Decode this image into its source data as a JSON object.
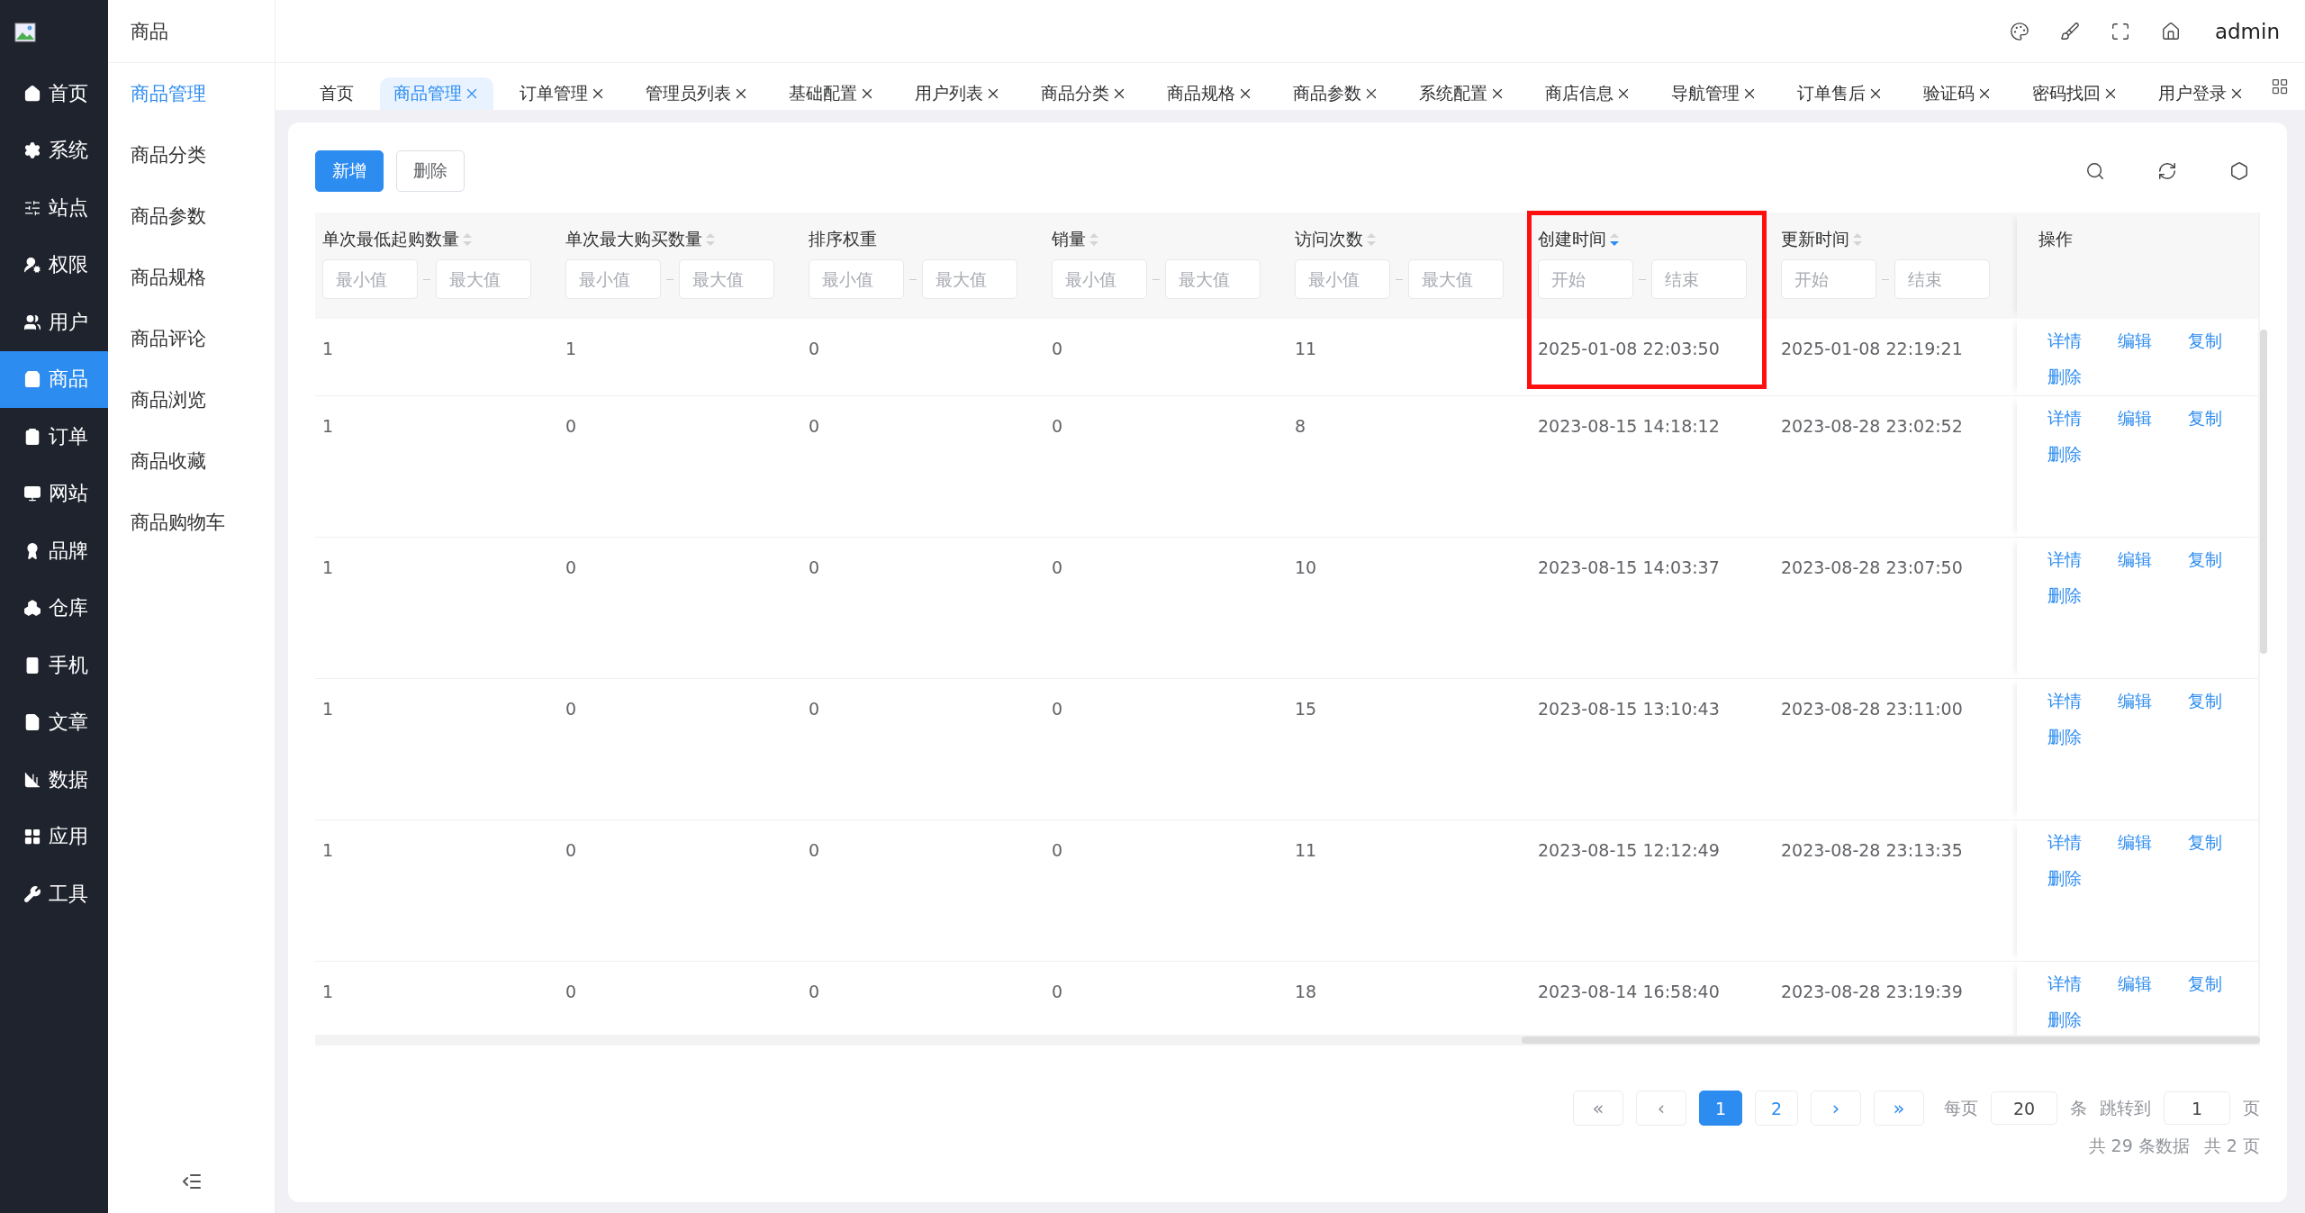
{
  "sidebar": {
    "items": [
      {
        "label": "首页",
        "selected": false
      },
      {
        "label": "系统",
        "selected": false
      },
      {
        "label": "站点",
        "selected": false
      },
      {
        "label": "权限",
        "selected": false
      },
      {
        "label": "用户",
        "selected": false
      },
      {
        "label": "商品",
        "selected": true
      },
      {
        "label": "订单",
        "selected": false
      },
      {
        "label": "网站",
        "selected": false
      },
      {
        "label": "品牌",
        "selected": false
      },
      {
        "label": "仓库",
        "selected": false
      },
      {
        "label": "手机",
        "selected": false
      },
      {
        "label": "文章",
        "selected": false
      },
      {
        "label": "数据",
        "selected": false
      },
      {
        "label": "应用",
        "selected": false
      },
      {
        "label": "工具",
        "selected": false
      }
    ]
  },
  "submenu": {
    "title": "商品",
    "items": [
      {
        "label": "商品管理",
        "selected": true
      },
      {
        "label": "商品分类",
        "selected": false
      },
      {
        "label": "商品参数",
        "selected": false
      },
      {
        "label": "商品规格",
        "selected": false
      },
      {
        "label": "商品评论",
        "selected": false
      },
      {
        "label": "商品浏览",
        "selected": false
      },
      {
        "label": "商品收藏",
        "selected": false
      },
      {
        "label": "商品购物车",
        "selected": false
      }
    ]
  },
  "header": {
    "user": "admin"
  },
  "tabs": [
    {
      "label": "首页",
      "selected": false,
      "closable": false
    },
    {
      "label": "商品管理",
      "selected": true,
      "closable": true
    },
    {
      "label": "订单管理",
      "selected": false,
      "closable": true
    },
    {
      "label": "管理员列表",
      "selected": false,
      "closable": true
    },
    {
      "label": "基础配置",
      "selected": false,
      "closable": true
    },
    {
      "label": "用户列表",
      "selected": false,
      "closable": true
    },
    {
      "label": "商品分类",
      "selected": false,
      "closable": true
    },
    {
      "label": "商品规格",
      "selected": false,
      "closable": true
    },
    {
      "label": "商品参数",
      "selected": false,
      "closable": true
    },
    {
      "label": "系统配置",
      "selected": false,
      "closable": true
    },
    {
      "label": "商店信息",
      "selected": false,
      "closable": true
    },
    {
      "label": "导航管理",
      "selected": false,
      "closable": true
    },
    {
      "label": "订单售后",
      "selected": false,
      "closable": true
    },
    {
      "label": "验证码",
      "selected": false,
      "closable": true
    },
    {
      "label": "密码找回",
      "selected": false,
      "closable": true
    },
    {
      "label": "用户登录",
      "selected": false,
      "closable": true
    }
  ],
  "toolbar": {
    "buttons": [
      {
        "label": "新增",
        "kind": "primary"
      },
      {
        "label": "删除",
        "kind": "default"
      }
    ]
  },
  "table": {
    "columns": [
      {
        "title": "单次最低起购数量",
        "sortable": true,
        "sorted_desc": false,
        "highlighted": false,
        "filter": [
          {
            "placeholder": "最小值"
          },
          {
            "placeholder": "最大值"
          }
        ]
      },
      {
        "title": "单次最大购买数量",
        "sortable": true,
        "sorted_desc": false,
        "highlighted": false,
        "filter": [
          {
            "placeholder": "最小值"
          },
          {
            "placeholder": "最大值"
          }
        ]
      },
      {
        "title": "排序权重",
        "sortable": false,
        "highlighted": false,
        "filter": [
          {
            "placeholder": "最小值"
          },
          {
            "placeholder": "最大值"
          }
        ]
      },
      {
        "title": "销量",
        "sortable": true,
        "sorted_desc": false,
        "highlighted": false,
        "filter": [
          {
            "placeholder": "最小值"
          },
          {
            "placeholder": "最大值"
          }
        ]
      },
      {
        "title": "访问次数",
        "sortable": true,
        "sorted_desc": false,
        "highlighted": false,
        "filter": [
          {
            "placeholder": "最小值"
          },
          {
            "placeholder": "最大值"
          }
        ]
      },
      {
        "title": "创建时间",
        "sortable": true,
        "sorted_desc": true,
        "highlighted": true,
        "filter": [
          {
            "placeholder": "开始"
          },
          {
            "placeholder": "结束"
          }
        ]
      },
      {
        "title": "更新时间",
        "sortable": true,
        "sorted_desc": false,
        "highlighted": false,
        "filter": [
          {
            "placeholder": "开始"
          },
          {
            "placeholder": "结束"
          }
        ]
      },
      {
        "title": "操作",
        "sortable": false,
        "highlighted": false
      }
    ],
    "rows": [
      {
        "cells": [
          "1",
          "1",
          "0",
          "0",
          "11",
          "2025-01-08 22:03:50",
          "2025-01-08 22:19:21"
        ],
        "actions": [
          "详情",
          "编辑",
          "复制",
          "删除"
        ]
      },
      {
        "cells": [
          "1",
          "0",
          "0",
          "0",
          "8",
          "2023-08-15 14:18:12",
          "2023-08-28 23:02:52"
        ],
        "actions": [
          "详情",
          "编辑",
          "复制",
          "删除"
        ]
      },
      {
        "cells": [
          "1",
          "0",
          "0",
          "0",
          "10",
          "2023-08-15 14:03:37",
          "2023-08-28 23:07:50"
        ],
        "actions": [
          "详情",
          "编辑",
          "复制",
          "删除"
        ]
      },
      {
        "cells": [
          "1",
          "0",
          "0",
          "0",
          "15",
          "2023-08-15 13:10:43",
          "2023-08-28 23:11:00"
        ],
        "actions": [
          "详情",
          "编辑",
          "复制",
          "删除"
        ]
      },
      {
        "cells": [
          "1",
          "0",
          "0",
          "0",
          "11",
          "2023-08-15 12:12:49",
          "2023-08-28 23:13:35"
        ],
        "actions": [
          "详情",
          "编辑",
          "复制",
          "删除"
        ]
      },
      {
        "cells": [
          "1",
          "0",
          "0",
          "0",
          "18",
          "2023-08-14 16:58:40",
          "2023-08-28 23:19:39"
        ],
        "actions": [
          "详情",
          "编辑",
          "复制",
          "删除"
        ]
      }
    ]
  },
  "pagination": {
    "nav_before": [
      {
        "label": "«",
        "disabled": true
      },
      {
        "label": "‹",
        "disabled": true
      }
    ],
    "pages": [
      {
        "label": "1",
        "selected": true
      },
      {
        "label": "2",
        "selected": false
      }
    ],
    "nav_after": [
      {
        "label": "›",
        "disabled": false
      },
      {
        "label": "»",
        "disabled": false
      }
    ],
    "page_size_label": "每页",
    "page_size": "20",
    "page_size_unit": "条",
    "jump_label": "跳转到",
    "jump_value": "1",
    "jump_unit": "页",
    "summary": [
      "共 29 条数据",
      "共 2 页"
    ]
  }
}
